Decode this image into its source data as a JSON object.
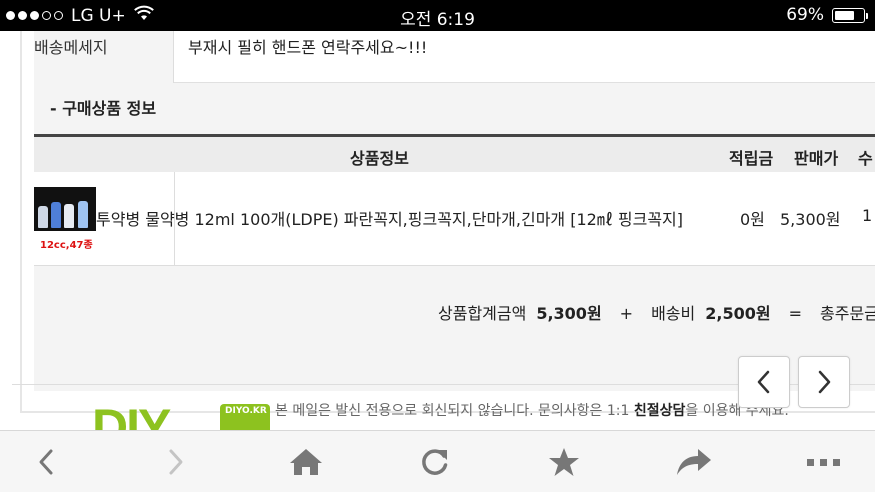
{
  "status_bar": {
    "carrier": "LG U+",
    "time": "오전 6:19",
    "battery_percent": "69%",
    "battery_level": 0.69,
    "signal_bars": 3
  },
  "order": {
    "message_label": "배송메세지",
    "message_value": "부재시 필히 핸드폰 연락주세요~!!!",
    "section_title": "- 구매상품 정보",
    "columns": {
      "info": "상품정보",
      "point": "적립금",
      "price": "판매가",
      "qty": "수"
    },
    "items": [
      {
        "thumb_label": "12cc,47종",
        "name": "투약병 물약병 12ml 100개(LDPE) 파란꼭지,핑크꼭지,단마개,긴마개 [12㎖ 핑크꼭지]",
        "point": "0원",
        "price": "5,300원",
        "qty": "1"
      }
    ],
    "totals": {
      "subtotal_label": "상품합계금액",
      "subtotal_value": "5,300원",
      "plus": "+",
      "shipping_label": "배송비",
      "shipping_value": "2,500원",
      "equals": "=",
      "grand_label": "총주문금"
    }
  },
  "footer": {
    "logo_text": "DIY",
    "logo_badge": "DIYO.KR",
    "notice_pre": "본 메일은 발신 전용으로 회신되지 않습니다. 문의사항은 1:1 ",
    "notice_bold": "친절상담",
    "notice_post": "을 이용해 주세요."
  },
  "toolbar": {
    "icons": [
      "back-icon",
      "forward-icon",
      "home-icon",
      "refresh-icon",
      "star-icon",
      "share-icon",
      "more-icon"
    ]
  },
  "colors": {
    "accent_green": "#8dc21f",
    "red_label": "#dd1111",
    "header_border": "#444444"
  }
}
